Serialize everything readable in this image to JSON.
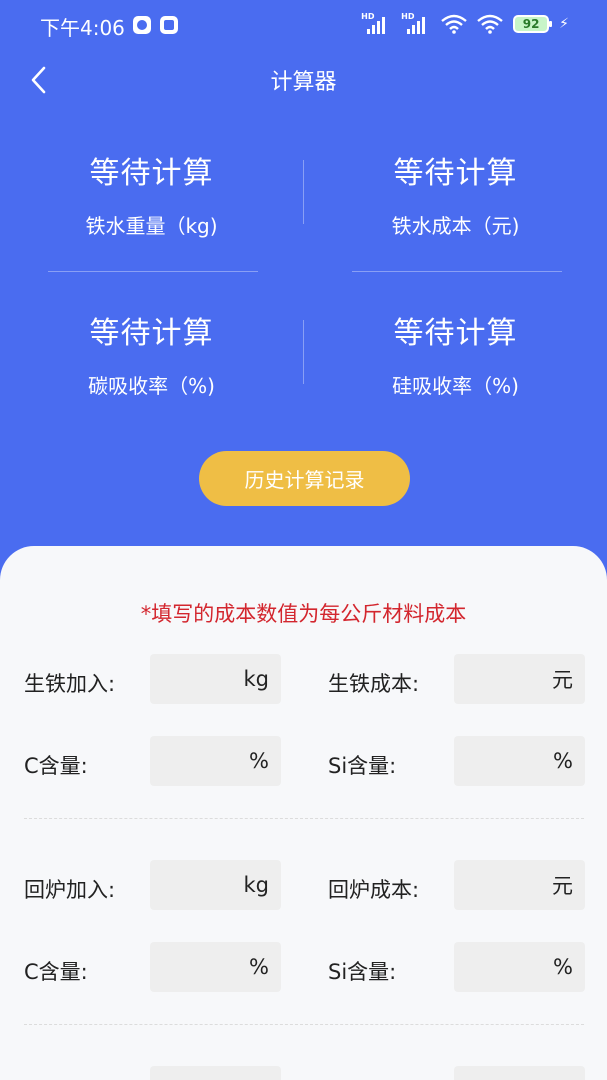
{
  "status_bar": {
    "time": "下午4:06",
    "battery": "92",
    "signal_tag": "HD"
  },
  "header": {
    "title": "计算器"
  },
  "results": [
    {
      "value": "等待计算",
      "label": "铁水重量（kg)"
    },
    {
      "value": "等待计算",
      "label": "铁水成本（元)"
    },
    {
      "value": "等待计算",
      "label": "碳吸收率（%)"
    },
    {
      "value": "等待计算",
      "label": "硅吸收率（%)"
    }
  ],
  "history_button": "历史计算记录",
  "form": {
    "notice": "*填写的成本数值为每公斤材料成本",
    "sections": [
      {
        "add_label": "生铁加入:",
        "add_unit": "kg",
        "cost_label": "生铁成本:",
        "cost_unit": "元",
        "c_label": "C含量:",
        "c_unit": "%",
        "si_label": "Si含量:",
        "si_unit": "%"
      },
      {
        "add_label": "回炉加入:",
        "add_unit": "kg",
        "cost_label": "回炉成本:",
        "cost_unit": "元",
        "c_label": "C含量:",
        "c_unit": "%",
        "si_label": "Si含量:",
        "si_unit": "%"
      }
    ]
  },
  "colors": {
    "primary": "#4a6cf0",
    "button": "#efbe45",
    "notice": "#d3262e",
    "panel": "#f7f8fa",
    "input_bg": "#eeeeee"
  }
}
